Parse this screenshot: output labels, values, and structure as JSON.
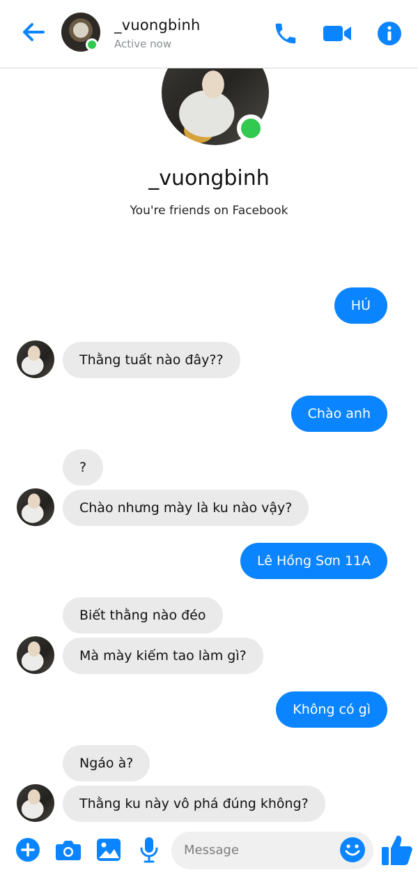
{
  "header": {
    "name": "_vuongbinh",
    "status": "Active now"
  },
  "profile": {
    "name": "_vuongbinh",
    "subtitle": "You're friends on Facebook"
  },
  "messages": [
    {
      "side": "out",
      "text": "HÚ"
    },
    {
      "side": "in",
      "text": "Thằng tuất nào đây??"
    },
    {
      "side": "out",
      "text": "Chào anh"
    },
    {
      "side": "in",
      "text": "?"
    },
    {
      "side": "in",
      "text": "Chào nhưng mày là ku nào vậy?"
    },
    {
      "side": "out",
      "text": "Lê Hồng Sơn 11A"
    },
    {
      "side": "in",
      "text": "Biết thằng nào đéo"
    },
    {
      "side": "in",
      "text": "Mà mày kiếm tao làm gì?"
    },
    {
      "side": "out",
      "text": "Không có gì"
    },
    {
      "side": "in",
      "text": "Ngáo à?"
    },
    {
      "side": "in",
      "text": "Thằng ku này vô phá đúng không?"
    }
  ],
  "composer": {
    "placeholder": "Message"
  },
  "icons": {
    "back": "arrow-left-icon",
    "call": "phone-icon",
    "video": "video-camera-icon",
    "info": "info-icon",
    "add": "plus-circle-icon",
    "camera": "camera-icon",
    "gallery": "image-icon",
    "voice": "microphone-icon",
    "emoji": "emoji-icon",
    "like": "thumbs-up-icon"
  },
  "colors": {
    "accent": "#0a84ff",
    "incoming_bubble": "#eaeaea",
    "online": "#31c950"
  }
}
